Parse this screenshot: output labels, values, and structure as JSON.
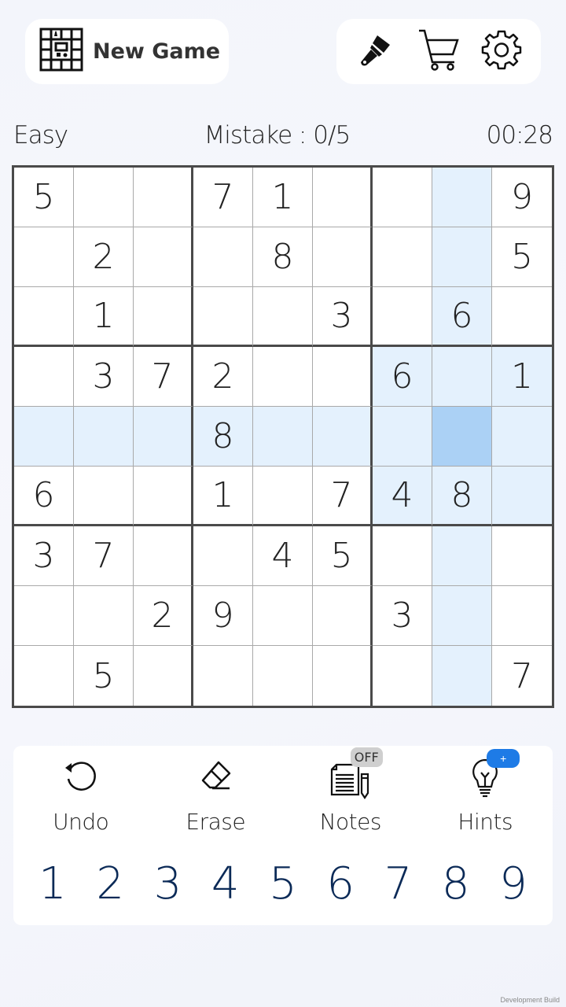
{
  "header": {
    "new_game_label": "New Game",
    "icons": [
      "theme-brush-icon",
      "shop-cart-icon",
      "settings-gear-icon"
    ]
  },
  "status": {
    "difficulty": "Easy",
    "mistakes": "Mistake : 0/5",
    "timer": "00:28"
  },
  "board": {
    "rows": [
      [
        "5",
        "",
        "",
        "7",
        "1",
        "",
        "",
        "",
        "9"
      ],
      [
        "",
        "2",
        "",
        "",
        "8",
        "",
        "",
        "",
        "5"
      ],
      [
        "",
        "1",
        "",
        "",
        "",
        "3",
        "",
        "6",
        ""
      ],
      [
        "",
        "3",
        "7",
        "2",
        "",
        "",
        "6",
        "",
        "1"
      ],
      [
        "",
        "",
        "",
        "8",
        "",
        "",
        "",
        "",
        ""
      ],
      [
        "6",
        "",
        "",
        "1",
        "",
        "7",
        "4",
        "8",
        ""
      ],
      [
        "3",
        "7",
        "",
        "",
        "4",
        "5",
        "",
        "",
        ""
      ],
      [
        "",
        "",
        "2",
        "9",
        "",
        "",
        "3",
        "",
        ""
      ],
      [
        "",
        "5",
        "",
        "",
        "",
        "",
        "",
        "",
        "7"
      ]
    ],
    "selected": {
      "row": 4,
      "col": 7
    },
    "highlight_color": "#e4f1fd",
    "selected_color": "#abd1f5"
  },
  "actions": {
    "undo": "Undo",
    "erase": "Erase",
    "notes": "Notes",
    "notes_state": "OFF",
    "hints": "Hints",
    "hints_badge": "+"
  },
  "numpad": [
    "1",
    "2",
    "3",
    "4",
    "5",
    "6",
    "7",
    "8",
    "9"
  ],
  "footer": {
    "dev_build": "Development Build"
  }
}
